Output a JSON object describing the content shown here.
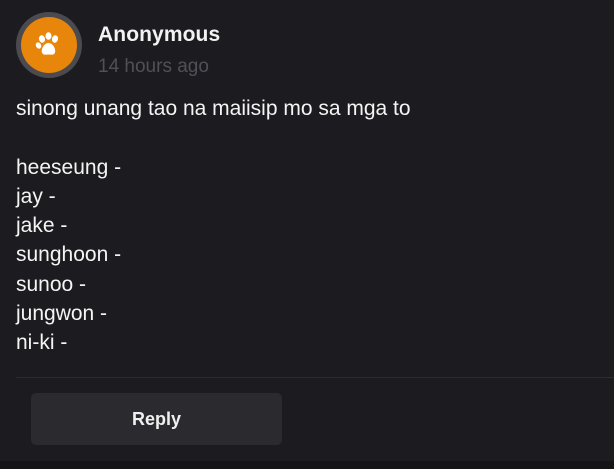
{
  "post": {
    "author": "Anonymous",
    "timestamp": "14 hours ago",
    "avatar_icon": "paw-icon",
    "avatar_color": "#e8860c",
    "lines": [
      "sinong unang tao na maiisip mo sa mga to",
      "",
      "heeseung -",
      "jay -",
      "jake -",
      "sunghoon -",
      "sunoo -",
      "jungwon -",
      "ni-ki -"
    ]
  },
  "actions": {
    "reply_label": "Reply"
  }
}
